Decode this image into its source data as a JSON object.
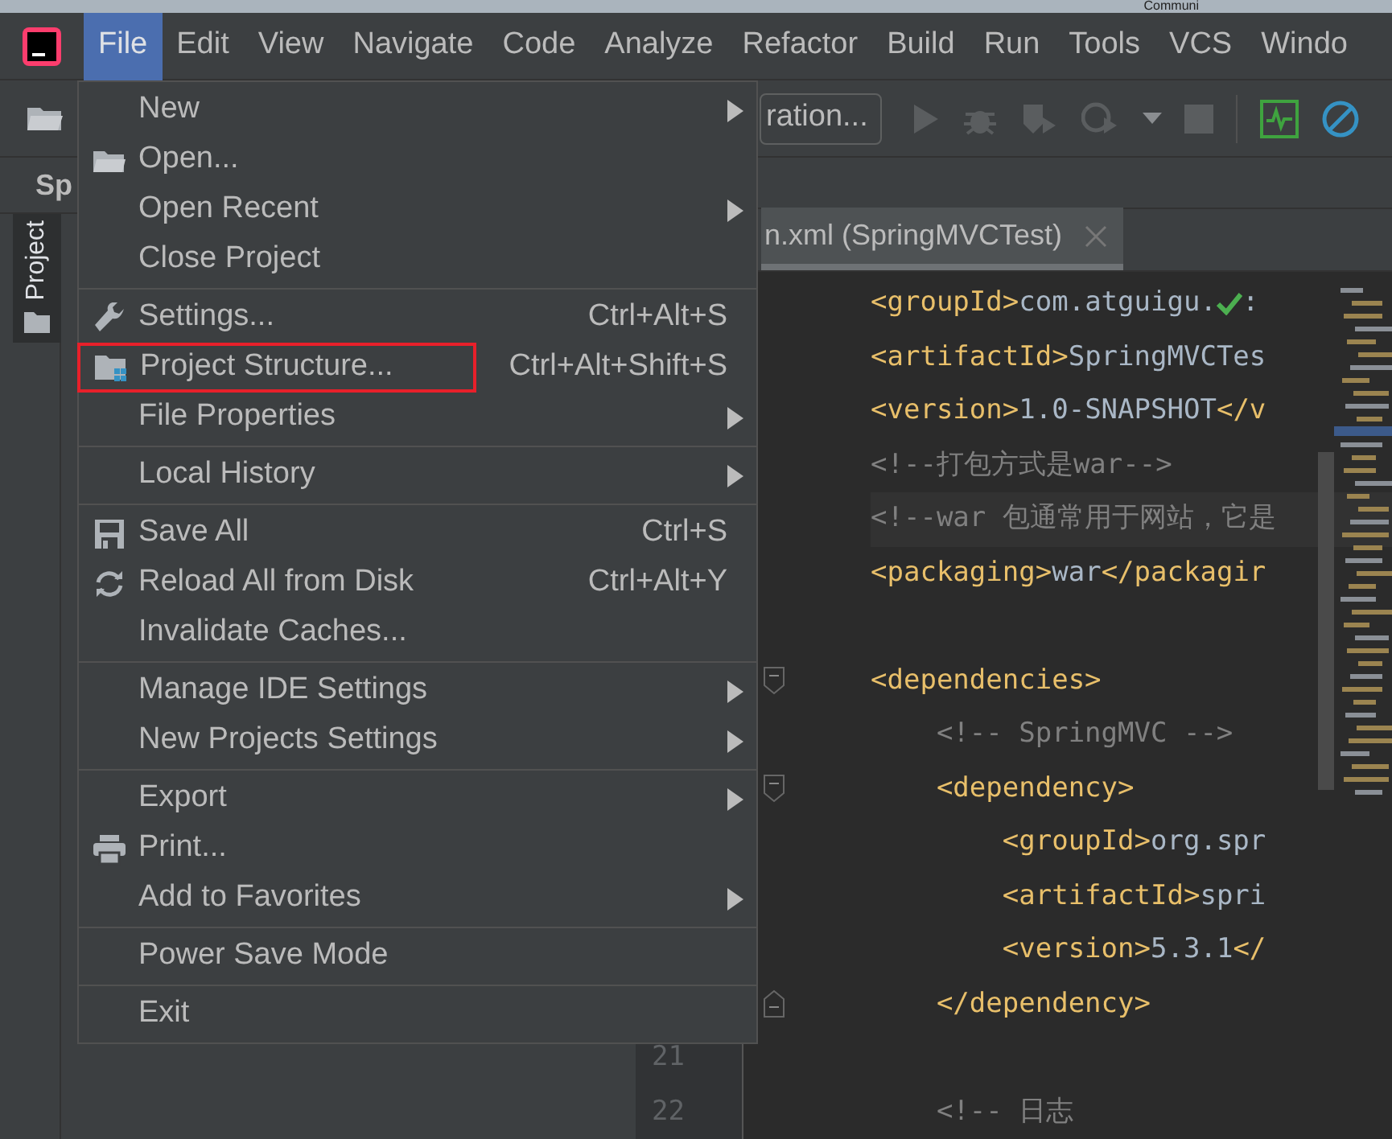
{
  "top_strip": {
    "text": "Communi"
  },
  "menu_bar": [
    {
      "label": "File",
      "selected": true
    },
    {
      "label": "Edit",
      "selected": false
    },
    {
      "label": "View",
      "selected": false
    },
    {
      "label": "Navigate",
      "selected": false
    },
    {
      "label": "Code",
      "selected": false
    },
    {
      "label": "Analyze",
      "selected": false
    },
    {
      "label": "Refactor",
      "selected": false
    },
    {
      "label": "Build",
      "selected": false
    },
    {
      "label": "Run",
      "selected": false
    },
    {
      "label": "Tools",
      "selected": false
    },
    {
      "label": "VCS",
      "selected": false
    },
    {
      "label": "Windo",
      "selected": false
    }
  ],
  "toolbar": {
    "configuration": "ration..."
  },
  "tool_window_tab": {
    "label": "Project",
    "selected": true
  },
  "project_panel": {
    "title": "Sp"
  },
  "editor_tab": {
    "label": "n.xml (SpringMVCTest)",
    "selected": true
  },
  "code_blocks": [
    [
      {
        "tokens": [
          {
            "kind": "tag",
            "text": "<groupId>"
          },
          {
            "kind": "text",
            "text": "com.atguigu."
          },
          {
            "kind": "check"
          },
          {
            "kind": "text",
            "text": ":"
          }
        ]
      },
      {
        "tokens": [
          {
            "kind": "tag",
            "text": "<artifactId>"
          },
          {
            "kind": "text",
            "text": "SpringMVCTes"
          }
        ]
      },
      {
        "tokens": [
          {
            "kind": "tag",
            "text": "<version>"
          },
          {
            "kind": "text",
            "text": "1.0-SNAPSHOT"
          },
          {
            "kind": "tag",
            "text": "</v"
          }
        ]
      },
      {
        "tokens": [
          {
            "kind": "comment",
            "text": "<!--打包方式是war-->"
          }
        ]
      },
      {
        "highlighted": true,
        "tokens": [
          {
            "kind": "comment",
            "text": "<!--war 包通常用于网站，它是"
          }
        ]
      },
      {
        "tokens": [
          {
            "kind": "tag",
            "text": "<packaging>"
          },
          {
            "kind": "text",
            "text": "war"
          },
          {
            "kind": "tag",
            "text": "</packagir"
          }
        ]
      }
    ],
    [
      {
        "fold_start": true,
        "tokens": [
          {
            "kind": "tag",
            "text": "<dependencies>"
          }
        ]
      },
      {
        "tokens": [
          {
            "kind": "comment",
            "text": "    <!-- SpringMVC -->"
          }
        ]
      },
      {
        "fold_start": true,
        "tokens": [
          {
            "kind": "tag",
            "text": "    <dependency>"
          }
        ]
      },
      {
        "tokens": [
          {
            "kind": "tag",
            "text": "        <groupId>"
          },
          {
            "kind": "text",
            "text": "org.spr"
          }
        ]
      },
      {
        "tokens": [
          {
            "kind": "tag",
            "text": "        <artifactId>"
          },
          {
            "kind": "text",
            "text": "spri"
          }
        ]
      },
      {
        "tokens": [
          {
            "kind": "tag",
            "text": "        <version>"
          },
          {
            "kind": "text",
            "text": "5.3.1"
          },
          {
            "kind": "tag",
            "text": "</"
          }
        ]
      },
      {
        "fold_end": true,
        "tokens": [
          {
            "kind": "tag",
            "text": "    </dependency>"
          }
        ]
      },
      {
        "number": "21"
      },
      {
        "number": "22",
        "tokens": [
          {
            "kind": "comment",
            "text": "    <!-- 日志"
          }
        ]
      }
    ]
  ],
  "file_menu": [
    [
      {
        "label": "New",
        "submenu": true
      },
      {
        "label": "Open...",
        "kind": "folder"
      },
      {
        "label": "Open Recent",
        "submenu": true
      },
      {
        "label": "Close Project"
      }
    ],
    [
      {
        "label": "Settings...",
        "kind": "wrench",
        "shortcut": "Ctrl+Alt+S"
      },
      {
        "label": "Project Structure...",
        "kind": "structure",
        "shortcut": "Ctrl+Alt+Shift+S",
        "outlined": true
      },
      {
        "label": "File Properties",
        "submenu": true
      }
    ],
    [
      {
        "label": "Local History",
        "submenu": true
      }
    ],
    [
      {
        "label": "Save All",
        "kind": "save",
        "shortcut": "Ctrl+S"
      },
      {
        "label": "Reload All from Disk",
        "kind": "reload",
        "shortcut": "Ctrl+Alt+Y"
      },
      {
        "label": "Invalidate Caches..."
      }
    ],
    [
      {
        "label": "Manage IDE Settings",
        "submenu": true
      },
      {
        "label": "New Projects Settings",
        "submenu": true
      }
    ],
    [
      {
        "label": "Export",
        "submenu": true
      },
      {
        "label": "Print...",
        "kind": "printer"
      },
      {
        "label": "Add to Favorites",
        "submenu": true
      }
    ],
    [
      {
        "label": "Power Save Mode"
      }
    ],
    [
      {
        "label": "Exit"
      }
    ]
  ]
}
